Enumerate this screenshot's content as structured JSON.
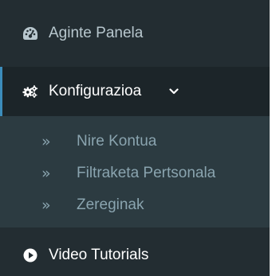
{
  "sidebar": {
    "dashboard": {
      "label": "Aginte Panela",
      "icon": "dashboard-gauge-icon"
    },
    "configuration": {
      "label": "Konfigurazioa",
      "icon": "cogs-icon",
      "expanded": true,
      "chevron": "chevron-down-icon",
      "accent_color": "#3c8dbc",
      "items": [
        {
          "label": "Nire Kontua",
          "icon": "double-angle-right-icon"
        },
        {
          "label": "Filtraketa Pertsonala",
          "icon": "double-angle-right-icon"
        },
        {
          "label": "Zereginak",
          "icon": "double-angle-right-icon"
        }
      ]
    },
    "video": {
      "label": "Video Tutorials",
      "icon": "play-circle-icon"
    }
  },
  "colors": {
    "sidebar_bg": "#232d32",
    "submenu_bg": "#2c3b41",
    "active_bg": "#1c2529",
    "text_primary": "#ffffff",
    "text_muted": "#8aa4af"
  }
}
